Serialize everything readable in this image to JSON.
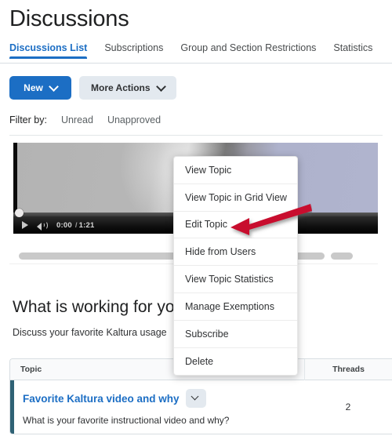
{
  "page": {
    "title": "Discussions"
  },
  "tabs": [
    {
      "label": "Discussions List",
      "active": true
    },
    {
      "label": "Subscriptions",
      "active": false
    },
    {
      "label": "Group and Section Restrictions",
      "active": false
    },
    {
      "label": "Statistics",
      "active": false
    }
  ],
  "toolbar": {
    "new_label": "New",
    "more_actions_label": "More Actions"
  },
  "filter": {
    "label": "Filter by:",
    "options": [
      "Unread",
      "Unapproved"
    ]
  },
  "video": {
    "play_icon": "play-icon",
    "volume_icon": "volume-icon",
    "current_time": "0:00",
    "separator": "/",
    "duration": "1:21"
  },
  "section": {
    "heading": "What is working for yo",
    "subheading": "Discuss your favorite Kaltura usage"
  },
  "context_menu": {
    "items": [
      "View Topic",
      "View Topic in Grid View",
      "Edit Topic",
      "Hide from Users",
      "View Topic Statistics",
      "Manage Exemptions",
      "Subscribe",
      "Delete"
    ],
    "highlighted": "Edit Topic"
  },
  "table": {
    "columns": [
      "Topic",
      "Threads"
    ],
    "rows": [
      {
        "topic": "Favorite Kaltura video and why",
        "description": "What is your favorite instructional video and why?",
        "threads": "2",
        "menu_icon": "chevron-down-icon"
      }
    ]
  },
  "annotation": {
    "arrow_color": "#c8102e",
    "points_at": "Edit Topic"
  },
  "colors": {
    "accent_blue": "#1c6ec4",
    "button_secondary": "#e3e9ef",
    "row_accent": "#2f6275",
    "arrow_red": "#c8102e"
  }
}
